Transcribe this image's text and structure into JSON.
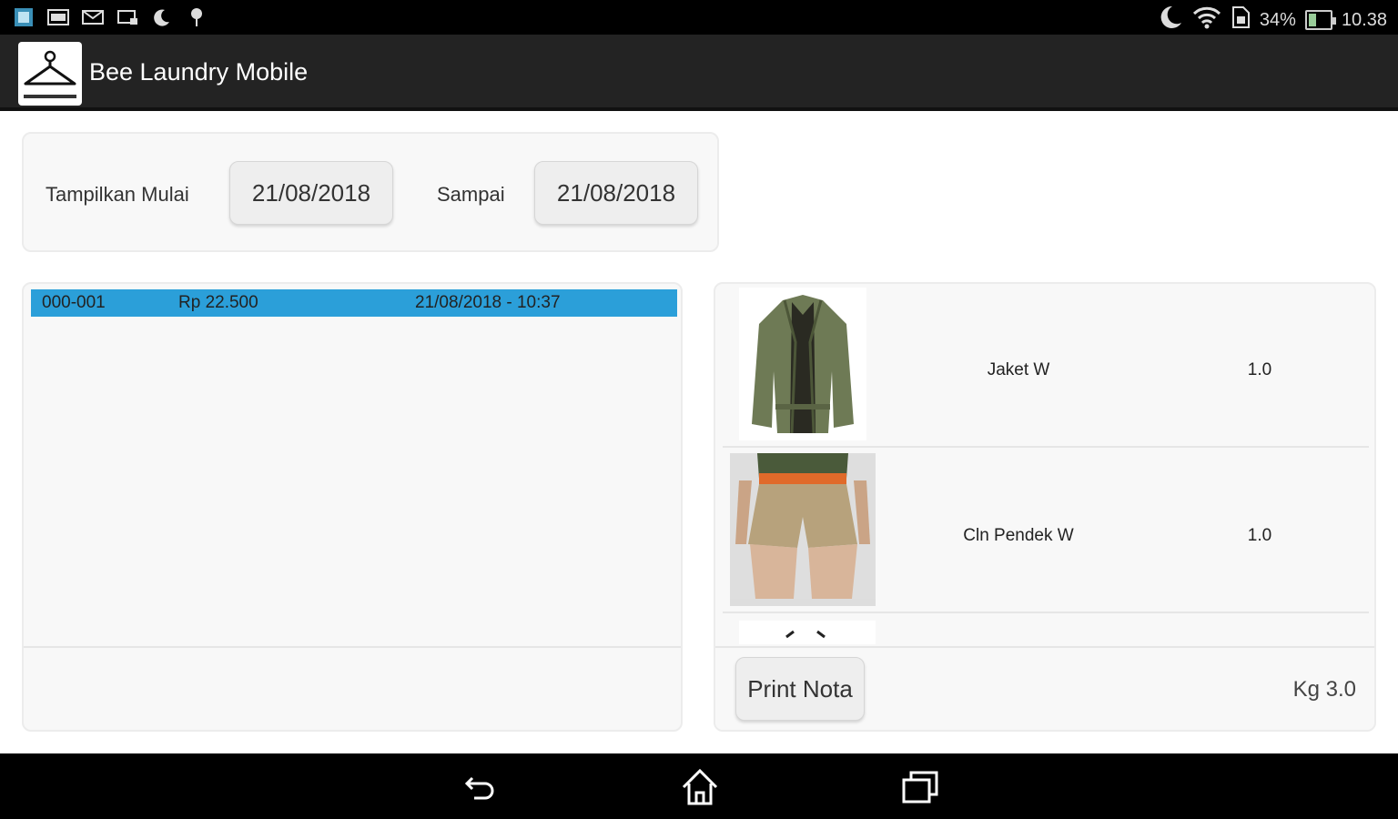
{
  "status_bar": {
    "battery": "34%",
    "time": "10.38",
    "left_icons": [
      "app-icon",
      "image-icon",
      "mail-icon",
      "cast-icon",
      "moon-icon",
      "pin-icon"
    ],
    "right_icons": [
      "moon-icon",
      "wifi-icon",
      "sim-icon",
      "battery-icon"
    ]
  },
  "app": {
    "title": "Bee Laundry Mobile",
    "logo": "hanger-icon"
  },
  "filter": {
    "start_label": "Tampilkan Mulai",
    "start_date": "21/08/2018",
    "end_label": "Sampai",
    "end_date": "21/08/2018"
  },
  "transactions": [
    {
      "id": "000-001",
      "amount": "Rp 22.500",
      "datetime": "21/08/2018 - 10:37",
      "selected": true
    }
  ],
  "items": [
    {
      "name": "Jaket W",
      "qty": "1.0",
      "image": "jacket-image"
    },
    {
      "name": "Cln Pendek W",
      "qty": "1.0",
      "image": "shorts-image"
    }
  ],
  "detail_footer": {
    "print_label": "Print Nota",
    "total": "Kg 3.0"
  },
  "colors": {
    "selection": "#2b9fd9",
    "actionbar": "#232323"
  },
  "nav": [
    "back-icon",
    "home-icon",
    "recents-icon"
  ]
}
